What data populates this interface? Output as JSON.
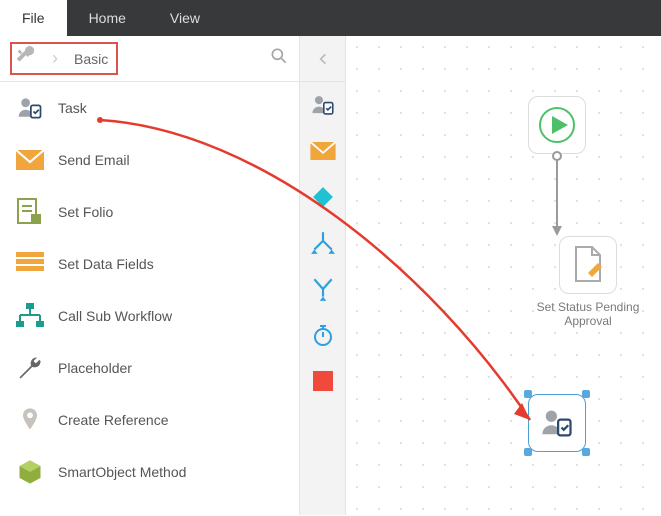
{
  "topbar": {
    "tabs": [
      {
        "label": "File",
        "active": true
      },
      {
        "label": "Home",
        "active": false
      },
      {
        "label": "View",
        "active": false
      }
    ]
  },
  "sidebar": {
    "breadcrumb": {
      "root_icon": "wrench-crossed",
      "current": "Basic"
    },
    "search_placeholder": "",
    "items": [
      {
        "label": "Task",
        "icon": "task"
      },
      {
        "label": "Send Email",
        "icon": "envelope"
      },
      {
        "label": "Set Folio",
        "icon": "folio"
      },
      {
        "label": "Set Data Fields",
        "icon": "datafields"
      },
      {
        "label": "Call Sub Workflow",
        "icon": "subworkflow"
      },
      {
        "label": "Placeholder",
        "icon": "wrench"
      },
      {
        "label": "Create Reference",
        "icon": "reference"
      },
      {
        "label": "SmartObject Method",
        "icon": "smartobject"
      }
    ]
  },
  "iconbar": {
    "items": [
      {
        "name": "task",
        "color": "#737a80"
      },
      {
        "name": "envelope",
        "color": "#f0a63c"
      },
      {
        "name": "diamond",
        "color": "#1ec2d4"
      },
      {
        "name": "split",
        "color": "#2ea0e0"
      },
      {
        "name": "merge",
        "color": "#2ea0e0"
      },
      {
        "name": "timer",
        "color": "#2ea0e0"
      },
      {
        "name": "stop",
        "color": "#ef4a3b"
      }
    ]
  },
  "canvas": {
    "nodes": {
      "start": {
        "label": "",
        "kind": "start"
      },
      "set_status": {
        "label": "Set Status Pending Approval",
        "kind": "document"
      },
      "task_drop": {
        "label": "",
        "kind": "task",
        "selected": true
      }
    }
  },
  "annotation": {
    "drag_arrow_from": "sidebar.task",
    "drag_arrow_to": "canvas.task_drop"
  }
}
